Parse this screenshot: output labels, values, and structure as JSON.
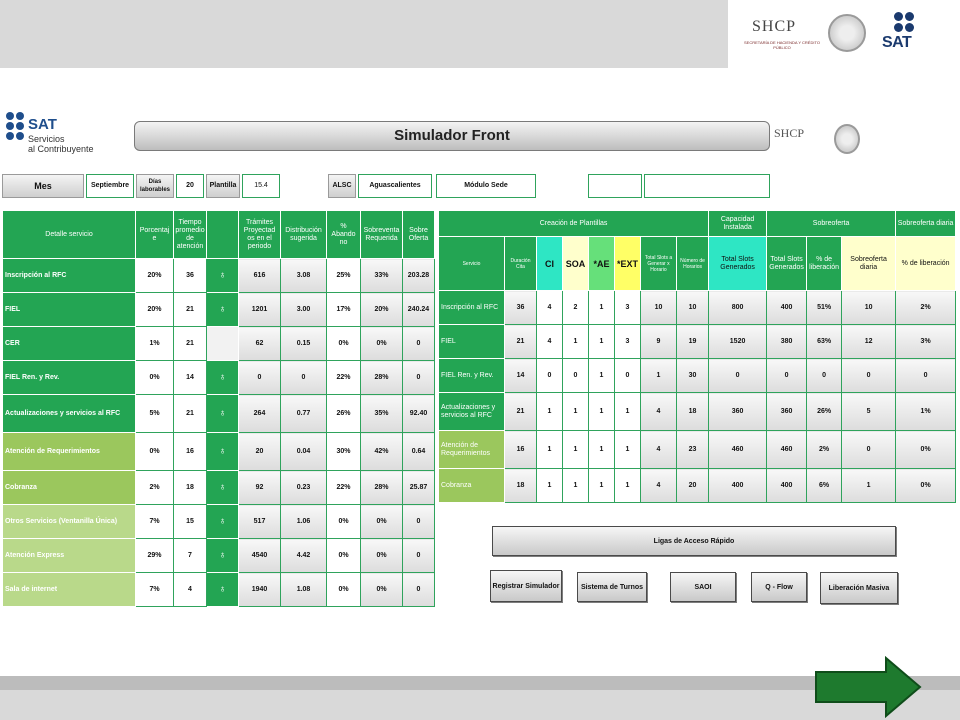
{
  "header": {
    "shcp_text": "SHCP",
    "shcp_sub": "SECRETARÍA DE HACIENDA Y CRÉDITO PÚBLICO",
    "sat_text": "SAT"
  },
  "app": {
    "sat_logo_title": "SAT",
    "sat_logo_subtitle_1": "Servicios",
    "sat_logo_subtitle_2": "al Contribuyente",
    "title": "Simulador Front",
    "shcp_small": "SHCP"
  },
  "params": {
    "mes_label": "Mes",
    "mes_value": "Septiembre",
    "dias_label": "Días laborables",
    "dias_value": "20",
    "plantilla_label": "Plantilla",
    "plantilla_value": "15.4",
    "alsc_label": "ALSC",
    "alsc_value": "Aguascalientes",
    "modulo_label": "Módulo Sede"
  },
  "left_table": {
    "headers": [
      "Detalle servicio",
      "Porcentaj e",
      "Tiempo promedio de atención",
      "",
      "Trámites Proyectad os en el periodo",
      "Distribución sugerida",
      "% Abando no",
      "Sobreventa Requerida",
      "Sobre Oferta"
    ],
    "rows": [
      {
        "name": "Inscripción al RFC",
        "pct": "20%",
        "tiempo": "36",
        "tramites": "616",
        "dist": "3.08",
        "aband": "25%",
        "sobrev": "33%",
        "sobreof": "203.28",
        "style": "g"
      },
      {
        "name": "FIEL",
        "pct": "20%",
        "tiempo": "21",
        "tramites": "1201",
        "dist": "3.00",
        "aband": "17%",
        "sobrev": "20%",
        "sobreof": "240.24",
        "style": "g"
      },
      {
        "name": "CER",
        "pct": "1%",
        "tiempo": "21",
        "tramites": "62",
        "dist": "0.15",
        "aband": "0%",
        "sobrev": "0%",
        "sobreof": "0",
        "style": "g",
        "noicon": true
      },
      {
        "name": "FIEL Ren. y Rev.",
        "pct": "0%",
        "tiempo": "14",
        "tramites": "0",
        "dist": "0",
        "aband": "22%",
        "sobrev": "28%",
        "sobreof": "0",
        "style": "g"
      },
      {
        "name": "Actualizaciones y servicios al RFC",
        "pct": "5%",
        "tiempo": "21",
        "tramites": "264",
        "dist": "0.77",
        "aband": "26%",
        "sobrev": "35%",
        "sobreof": "92.40",
        "style": "g"
      },
      {
        "name": "Atención de Requerimientos",
        "pct": "0%",
        "tiempo": "16",
        "tramites": "20",
        "dist": "0.04",
        "aband": "30%",
        "sobrev": "42%",
        "sobreof": "0.64",
        "style": "o"
      },
      {
        "name": "Cobranza",
        "pct": "2%",
        "tiempo": "18",
        "tramites": "92",
        "dist": "0.23",
        "aband": "22%",
        "sobrev": "28%",
        "sobreof": "25.87",
        "style": "o"
      },
      {
        "name": "Otros Servicios (Ventanilla Única)",
        "pct": "7%",
        "tiempo": "15",
        "tramites": "517",
        "dist": "1.06",
        "aband": "0%",
        "sobrev": "0%",
        "sobreof": "0",
        "style": "l"
      },
      {
        "name": "Atención Express",
        "pct": "29%",
        "tiempo": "7",
        "tramites": "4540",
        "dist": "4.42",
        "aband": "0%",
        "sobrev": "0%",
        "sobreof": "0",
        "style": "l"
      },
      {
        "name": "Sala de internet",
        "pct": "7%",
        "tiempo": "4",
        "tramites": "1940",
        "dist": "1.08",
        "aband": "0%",
        "sobrev": "0%",
        "sobreof": "0",
        "style": "l"
      }
    ]
  },
  "right_table": {
    "group_headers": [
      "Creación de Plantillas",
      "Capacidad Instalada",
      "Sobreoferta",
      "Sobreoferta diaria"
    ],
    "headers": [
      "Servicio",
      "Duración Cita",
      "CI",
      "SOA",
      "*AE",
      "*EXT",
      "Total Slots a Generar x Horario",
      "Número de Horarios",
      "Total Slots Generados",
      "Total Slots Generados",
      "% de liberación",
      "Sobreoferta diaria",
      "% de liberación"
    ],
    "rows": [
      {
        "name": "Inscripción al RFC",
        "v": [
          "36",
          "4",
          "2",
          "1",
          "3",
          "10",
          "10",
          "800",
          "400",
          "51%",
          "10",
          "2%"
        ]
      },
      {
        "name": "FIEL",
        "v": [
          "21",
          "4",
          "1",
          "1",
          "3",
          "9",
          "19",
          "1520",
          "380",
          "63%",
          "12",
          "3%"
        ]
      },
      {
        "name": "FIEL Ren. y Rev.",
        "v": [
          "14",
          "0",
          "0",
          "1",
          "0",
          "1",
          "30",
          "0",
          "0",
          "0",
          "0",
          "0"
        ]
      },
      {
        "name": "Actualizaciones y servicios al RFC",
        "v": [
          "21",
          "1",
          "1",
          "1",
          "1",
          "4",
          "18",
          "360",
          "360",
          "26%",
          "5",
          "1%"
        ]
      },
      {
        "name": "Atención de Requerimientos",
        "v": [
          "16",
          "1",
          "1",
          "1",
          "1",
          "4",
          "23",
          "460",
          "460",
          "2%",
          "0",
          "0%"
        ]
      },
      {
        "name": "Cobranza",
        "v": [
          "18",
          "1",
          "1",
          "1",
          "1",
          "4",
          "20",
          "400",
          "400",
          "6%",
          "1",
          "0%"
        ]
      }
    ]
  },
  "quick_links": {
    "title": "Ligas de Acceso Rápido",
    "buttons": [
      "Registrar Simulador",
      "Sistema de Turnos",
      "SAOI",
      "Q - Flow",
      "Liberación Masiva"
    ]
  },
  "icons": {
    "person": "♁"
  },
  "colors": {
    "green": "#23a553",
    "olive": "#9bc75d",
    "light_olive": "#b9d98a",
    "cyan": "#2ee6c4",
    "yellow": "#ffff66",
    "arrow": "#1e7a2e"
  }
}
